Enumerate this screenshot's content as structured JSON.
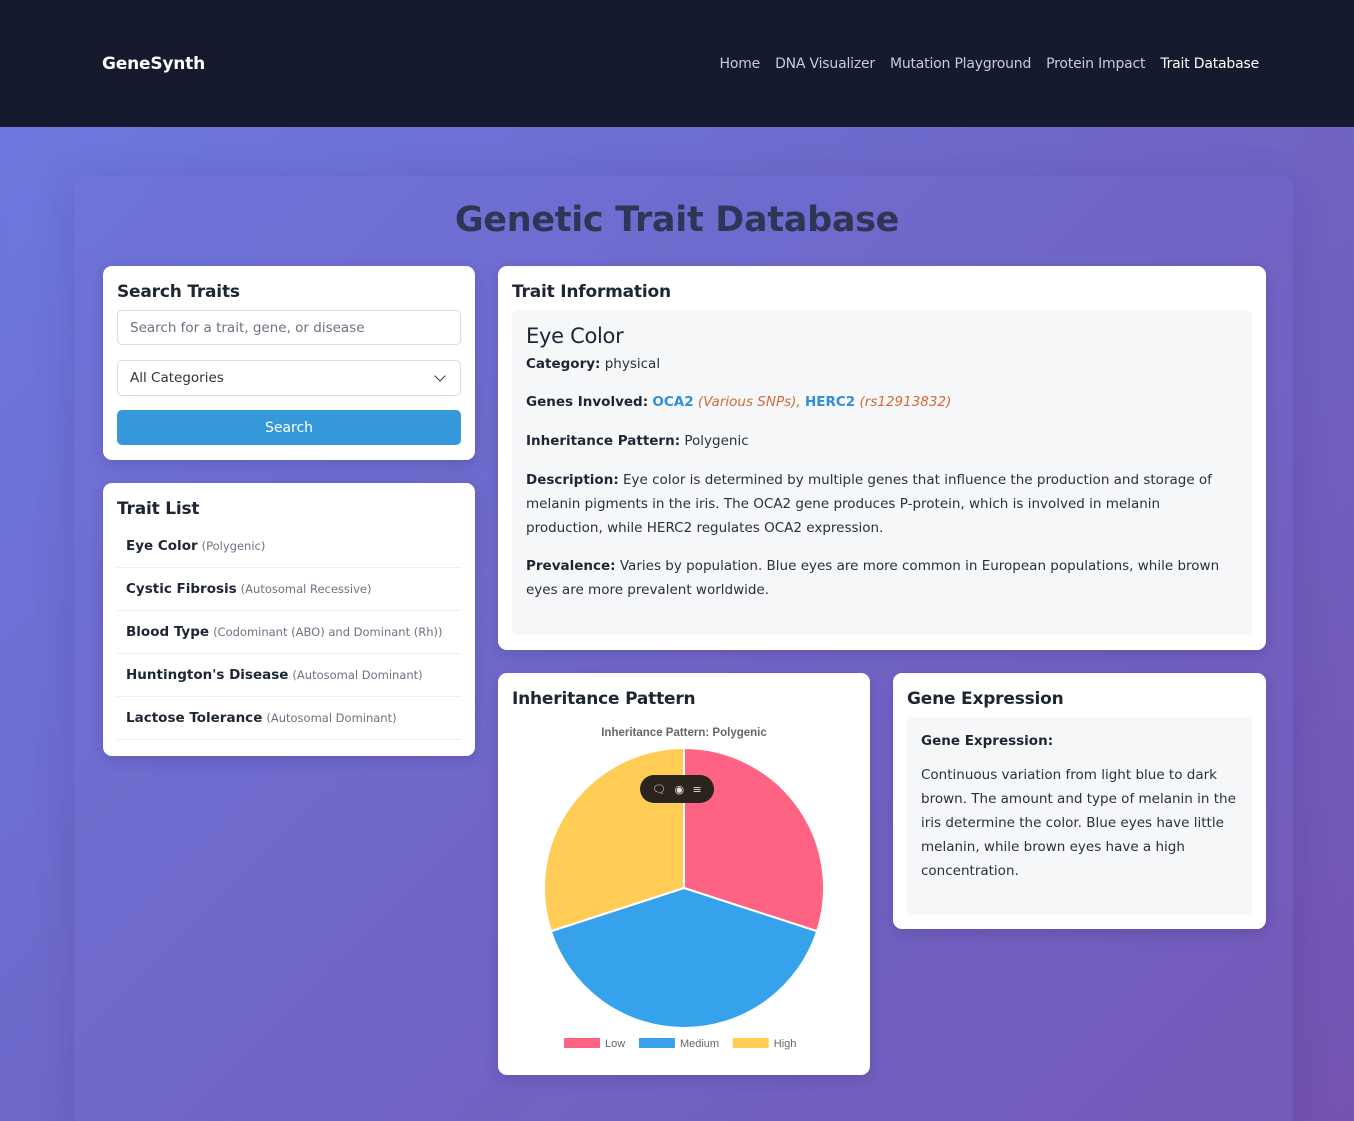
{
  "nav": {
    "brand": "GeneSynth",
    "links": [
      "Home",
      "DNA Visualizer",
      "Mutation Playground",
      "Protein Impact",
      "Trait Database"
    ],
    "active": "Trait Database"
  },
  "page_title": "Genetic Trait Database",
  "search": {
    "title": "Search Traits",
    "placeholder": "Search for a trait, gene, or disease",
    "category_selected": "All Categories",
    "button": "Search"
  },
  "trait_list": {
    "title": "Trait List",
    "items": [
      {
        "name": "Eye Color",
        "pattern": "(Polygenic)"
      },
      {
        "name": "Cystic Fibrosis",
        "pattern": "(Autosomal Recessive)"
      },
      {
        "name": "Blood Type",
        "pattern": "(Codominant (ABO) and Dominant (Rh))"
      },
      {
        "name": "Huntington's Disease",
        "pattern": "(Autosomal Dominant)"
      },
      {
        "name": "Lactose Tolerance",
        "pattern": "(Autosomal Dominant)"
      }
    ]
  },
  "trait_info": {
    "title": "Trait Information",
    "name": "Eye Color",
    "category_label": "Category:",
    "category": "physical",
    "genes_label": "Genes Involved:",
    "genes": [
      {
        "name": "OCA2",
        "note": "(Various SNPs)"
      },
      {
        "name": "HERC2",
        "note": "(rs12913832)"
      }
    ],
    "inheritance_label": "Inheritance Pattern:",
    "inheritance": "Polygenic",
    "description_label": "Description:",
    "description": "Eye color is determined by multiple genes that influence the production and storage of melanin pigments in the iris. The OCA2 gene produces P-protein, which is involved in melanin production, while HERC2 regulates OCA2 expression.",
    "prevalence_label": "Prevalence:",
    "prevalence": "Varies by population. Blue eyes are more common in European populations, while brown eyes are more prevalent worldwide."
  },
  "inheritance_card": {
    "title": "Inheritance Pattern",
    "overlay_icons": [
      "comment-icon",
      "toggle-icon",
      "menu-icon"
    ]
  },
  "chart_data": {
    "type": "pie",
    "title": "Inheritance Pattern: Polygenic",
    "categories": [
      "Low",
      "Medium",
      "High"
    ],
    "values": [
      30,
      40,
      30
    ],
    "colors": [
      "#ff6384",
      "#36a2eb",
      "#ffcd56"
    ],
    "legend": "bottom"
  },
  "gene_expression": {
    "title": "Gene Expression",
    "label": "Gene Expression:",
    "text": "Continuous variation from light blue to dark brown. The amount and type of melanin in the iris determine the color. Blue eyes have little melanin, while brown eyes have a high concentration."
  }
}
